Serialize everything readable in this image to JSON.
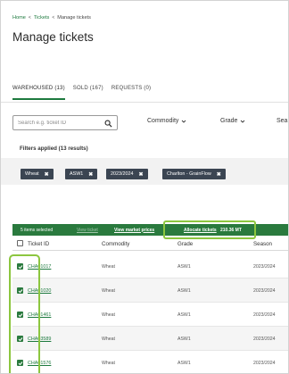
{
  "breadcrumb": {
    "home": "Home",
    "tickets": "Tickets",
    "current": "Manage tickets",
    "separator": "<"
  },
  "page": {
    "title": "Manage tickets"
  },
  "tabs": [
    {
      "label": "WAREHOUSED (13)",
      "active": true
    },
    {
      "label": "SOLD (167)",
      "active": false
    },
    {
      "label": "REQUESTS (0)",
      "active": false
    }
  ],
  "search": {
    "placeholder": "Search e.g. ticket ID",
    "value": ""
  },
  "filters": {
    "commodity": "Commodity",
    "grade": "Grade",
    "season": "Sea"
  },
  "filters_applied": "Filters applied (13 results)",
  "chips": [
    {
      "label": "Wheat",
      "remove": "✖"
    },
    {
      "label": "ASW1",
      "remove": "✖"
    },
    {
      "label": "2023/2024",
      "remove": "✖"
    },
    {
      "label": "Charlton - GrainFlow",
      "remove": "✖"
    }
  ],
  "action_bar": {
    "selected": "5 items selected",
    "view_ticket": "View ticket",
    "view_market_prices": "View market prices",
    "allocate_tickets": "Allocate tickets",
    "quantity": "210.36 MT"
  },
  "table": {
    "headers": {
      "ticket_id": "Ticket ID",
      "commodity": "Commodity",
      "grade": "Grade",
      "season": "Season"
    },
    "rows": [
      {
        "ticket_id": "CHA01017",
        "commodity": "Wheat",
        "grade": "ASW1",
        "season": "2023/2024"
      },
      {
        "ticket_id": "CHA01020",
        "commodity": "Wheat",
        "grade": "ASW1",
        "season": "2023/2024"
      },
      {
        "ticket_id": "CHA01461",
        "commodity": "Wheat",
        "grade": "ASW1",
        "season": "2023/2024"
      },
      {
        "ticket_id": "CHA03589",
        "commodity": "Wheat",
        "grade": "ASW1",
        "season": "2023/2024"
      },
      {
        "ticket_id": "CHA01576",
        "commodity": "Wheat",
        "grade": "ASW1",
        "season": "2023/2024"
      }
    ]
  },
  "colors": {
    "brand_green": "#2a7a3e",
    "highlight": "#8cc63f",
    "chip_bg": "#3b4552"
  }
}
